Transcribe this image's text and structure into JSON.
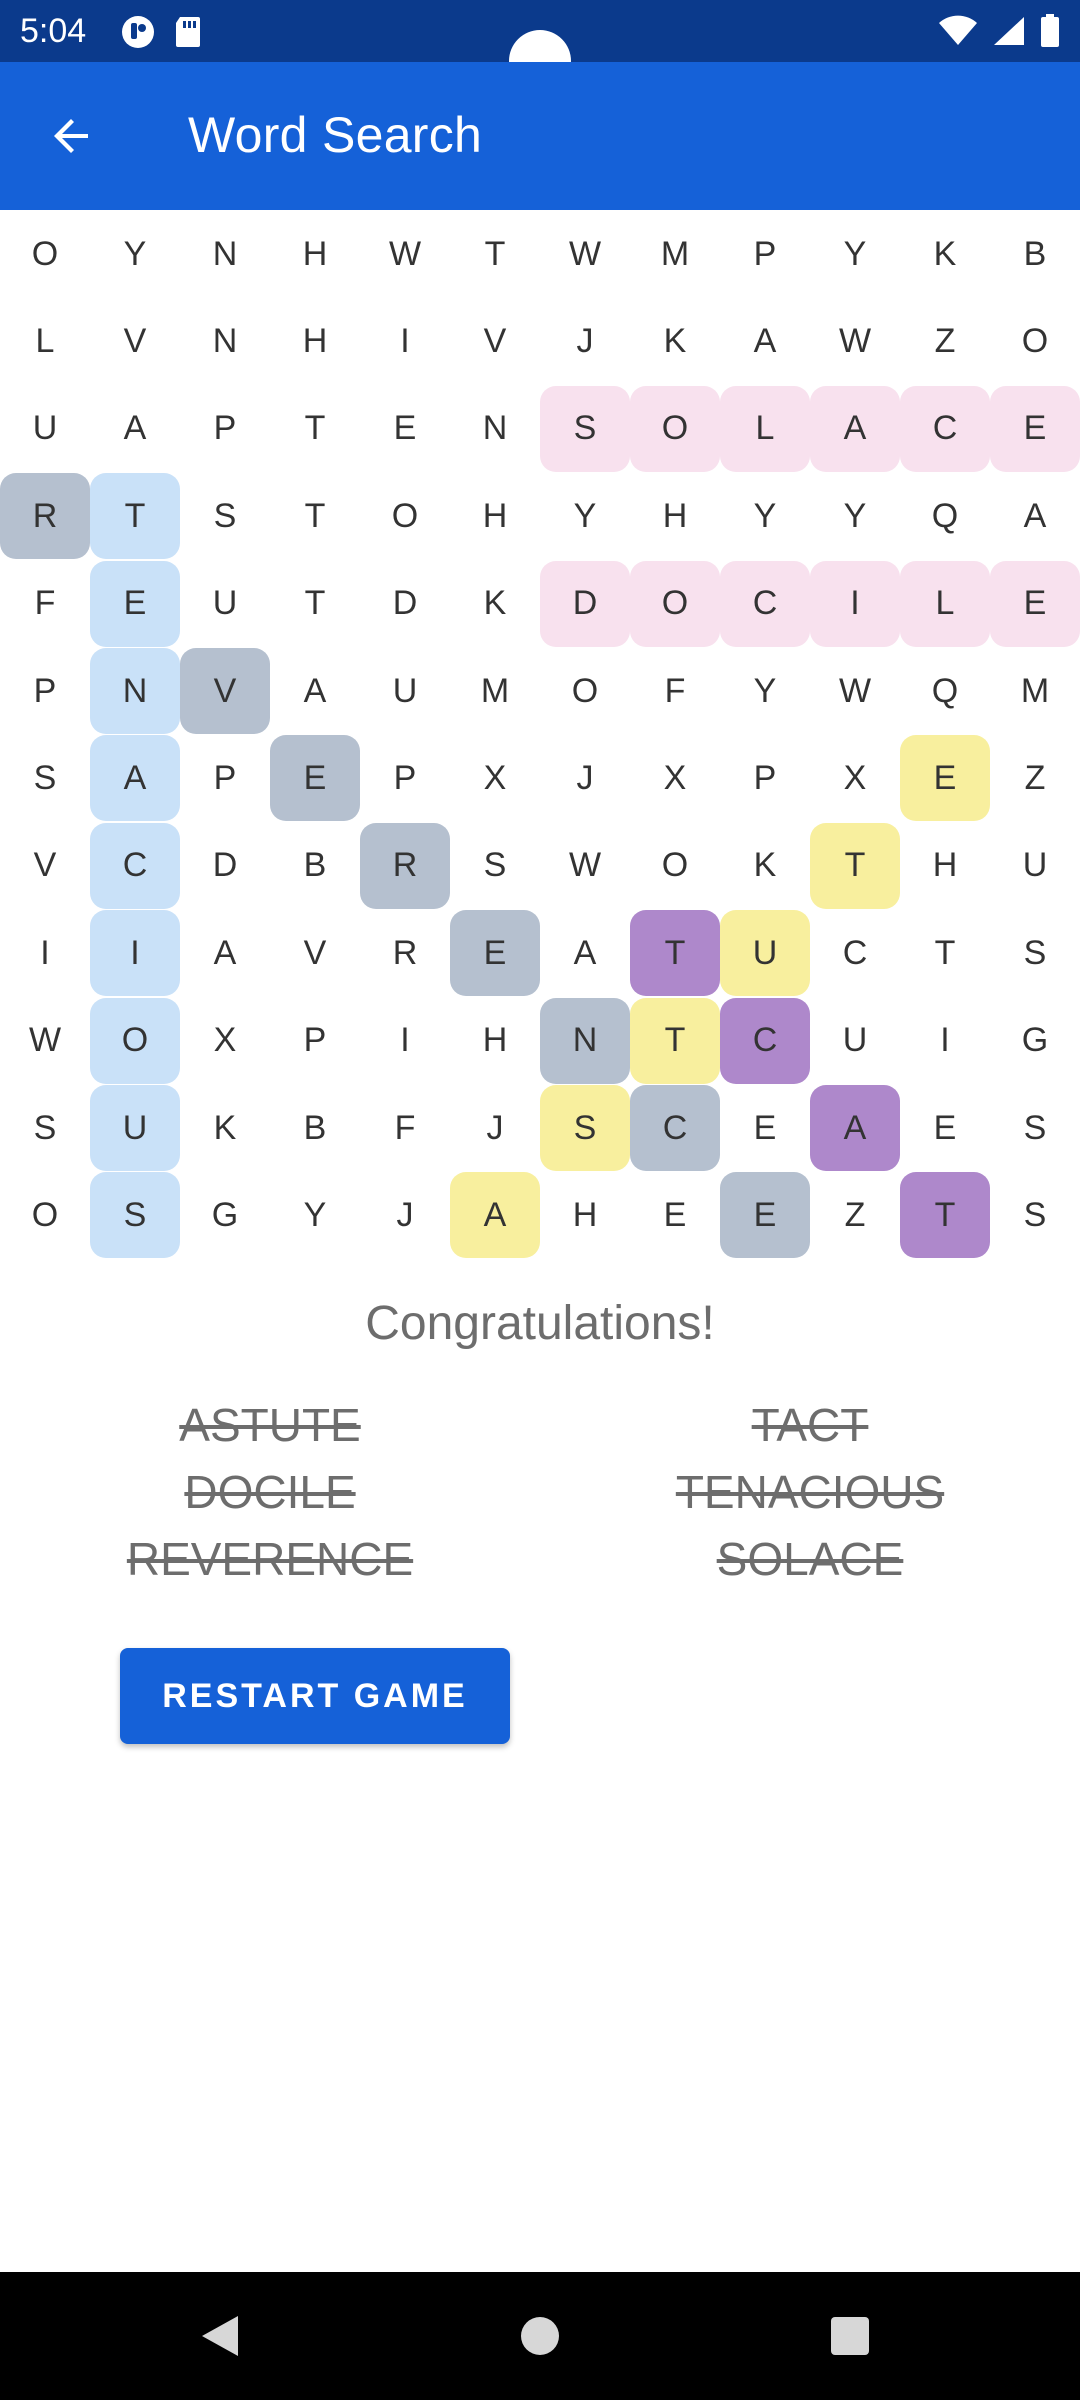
{
  "status_bar": {
    "time": "5:04",
    "left_icons": [
      "notification-app-icon",
      "sd-card-icon"
    ],
    "right_icons": [
      "wifi-icon",
      "signal-icon",
      "battery-icon"
    ]
  },
  "app_bar": {
    "title": "Word Search",
    "back_icon": "arrow-back-icon"
  },
  "colors": {
    "app_bar": "#1561d8",
    "status_bar": "#0b3a8c",
    "pink": "#f8e1ee",
    "blue": "#c9e1f8",
    "gray": "#b5c0cf",
    "yellow": "#f8ef9e",
    "purple": "#ae88cb"
  },
  "grid": {
    "rows": [
      [
        "O",
        "Y",
        "N",
        "H",
        "W",
        "T",
        "W",
        "M",
        "P",
        "Y",
        "K",
        "B"
      ],
      [
        "L",
        "V",
        "N",
        "H",
        "I",
        "V",
        "J",
        "K",
        "A",
        "W",
        "Z",
        "O"
      ],
      [
        "U",
        "A",
        "P",
        "T",
        "E",
        "N",
        "S",
        "O",
        "L",
        "A",
        "C",
        "E"
      ],
      [
        "R",
        "T",
        "S",
        "T",
        "O",
        "H",
        "Y",
        "H",
        "Y",
        "Y",
        "Q",
        "A"
      ],
      [
        "F",
        "E",
        "U",
        "T",
        "D",
        "K",
        "D",
        "O",
        "C",
        "I",
        "L",
        "E"
      ],
      [
        "P",
        "N",
        "V",
        "A",
        "U",
        "M",
        "O",
        "F",
        "Y",
        "W",
        "Q",
        "M"
      ],
      [
        "S",
        "A",
        "P",
        "E",
        "P",
        "X",
        "J",
        "X",
        "P",
        "X",
        "E",
        "Z"
      ],
      [
        "V",
        "C",
        "D",
        "B",
        "R",
        "S",
        "W",
        "O",
        "K",
        "T",
        "H",
        "U"
      ],
      [
        "I",
        "I",
        "A",
        "V",
        "R",
        "E",
        "A",
        "T",
        "U",
        "C",
        "T",
        "S"
      ],
      [
        "W",
        "O",
        "X",
        "P",
        "I",
        "H",
        "N",
        "T",
        "C",
        "U",
        "I",
        "G"
      ],
      [
        "S",
        "U",
        "K",
        "B",
        "F",
        "J",
        "S",
        "C",
        "E",
        "A",
        "E",
        "S"
      ],
      [
        "O",
        "S",
        "G",
        "Y",
        "J",
        "A",
        "H",
        "E",
        "E",
        "Z",
        "T",
        "S"
      ]
    ],
    "highlights": [
      {
        "word": "SOLACE",
        "color": "pink",
        "cells": [
          [
            2,
            6
          ],
          [
            2,
            7
          ],
          [
            2,
            8
          ],
          [
            2,
            9
          ],
          [
            2,
            10
          ],
          [
            2,
            11
          ]
        ]
      },
      {
        "word": "DOCILE",
        "color": "pink",
        "cells": [
          [
            4,
            6
          ],
          [
            4,
            7
          ],
          [
            4,
            8
          ],
          [
            4,
            9
          ],
          [
            4,
            10
          ],
          [
            4,
            11
          ]
        ]
      },
      {
        "word": "TENACIOUS",
        "color": "blue",
        "cells": [
          [
            3,
            1
          ],
          [
            4,
            1
          ],
          [
            5,
            1
          ],
          [
            6,
            1
          ],
          [
            7,
            1
          ],
          [
            8,
            1
          ],
          [
            9,
            1
          ],
          [
            10,
            1
          ],
          [
            11,
            1
          ]
        ]
      },
      {
        "word": "REVERENCE",
        "color": "gray",
        "cells": [
          [
            3,
            0
          ],
          [
            5,
            2
          ],
          [
            6,
            3
          ],
          [
            7,
            4
          ],
          [
            8,
            5
          ],
          [
            9,
            6
          ],
          [
            10,
            7
          ],
          [
            11,
            8
          ]
        ]
      },
      {
        "word": "ASTUTE",
        "color": "yellow",
        "cells": [
          [
            11,
            5
          ],
          [
            10,
            6
          ],
          [
            9,
            7
          ],
          [
            8,
            8
          ],
          [
            7,
            9
          ],
          [
            6,
            10
          ]
        ]
      },
      {
        "word": "TACT",
        "color": "purple",
        "cells": [
          [
            8,
            7
          ],
          [
            9,
            8
          ],
          [
            10,
            9
          ],
          [
            11,
            10
          ]
        ]
      }
    ]
  },
  "congrats": "Congratulations!",
  "words_left": [
    "ASTUTE",
    "DOCILE",
    "REVERENCE"
  ],
  "words_right": [
    "TACT",
    "TENACIOUS",
    "SOLACE"
  ],
  "restart_label": "RESTART GAME",
  "nav_bar": {
    "icons": [
      "nav-back-icon",
      "nav-home-icon",
      "nav-recents-icon"
    ]
  }
}
